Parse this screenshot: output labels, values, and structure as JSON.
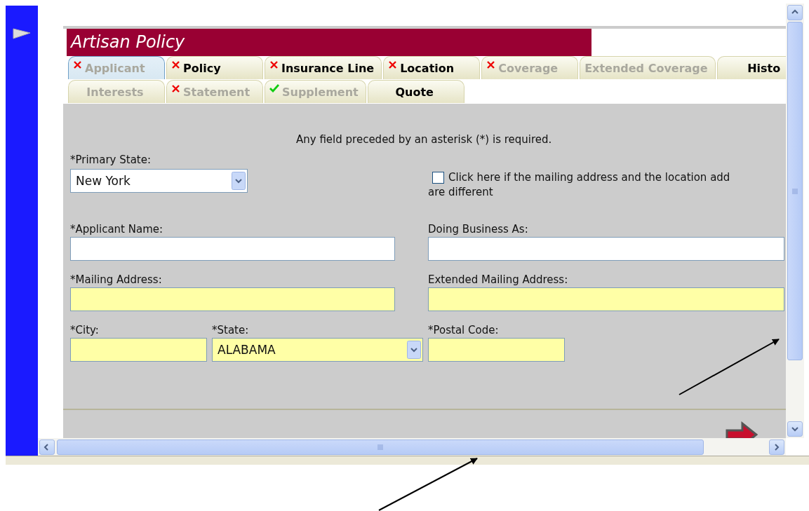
{
  "form_title": "Artisan Policy",
  "tab_rows": [
    {
      "tabs": [
        {
          "label": "Applicant",
          "kind": "error",
          "disabled": true,
          "selected": true
        },
        {
          "label": "Policy",
          "kind": "error",
          "disabled": false,
          "selected": false
        },
        {
          "label": "Insurance Line",
          "kind": "error",
          "disabled": false,
          "selected": false
        },
        {
          "label": "Location",
          "kind": "error",
          "disabled": false,
          "selected": false
        },
        {
          "label": "Coverage",
          "kind": "error",
          "disabled": true,
          "selected": false
        },
        {
          "label": "Extended Coverage",
          "kind": "plain",
          "disabled": true,
          "selected": false
        },
        {
          "label": "Histo",
          "kind": "plain",
          "disabled": false,
          "selected": false
        }
      ]
    },
    {
      "tabs": [
        {
          "label": "Interests",
          "kind": "plain",
          "disabled": true,
          "selected": false
        },
        {
          "label": "Statement",
          "kind": "error",
          "disabled": true,
          "selected": false
        },
        {
          "label": "Supplement",
          "kind": "complete",
          "disabled": true,
          "selected": false
        },
        {
          "label": "Quote",
          "kind": "plain",
          "disabled": false,
          "selected": false
        }
      ]
    }
  ],
  "notice": "Any field preceded by an asterisk (*) is required.",
  "primary_state": {
    "label": "*Primary State:",
    "value": "New York"
  },
  "mailing_checkbox": {
    "checked": false,
    "label_lines": [
      "Click here if the mailing address and the location add",
      "are different"
    ]
  },
  "fields": [
    {
      "label": "*Applicant Name:",
      "kind": "text",
      "highlighted": false
    },
    {
      "label": "Doing Business As:",
      "kind": "text",
      "highlighted": false
    },
    {
      "label": "*Mailing Address:",
      "kind": "text",
      "highlighted": true
    },
    {
      "label": "Extended Mailing Address:",
      "kind": "text",
      "highlighted": true
    },
    {
      "label": "*City:",
      "kind": "text",
      "highlighted": true
    },
    {
      "label": "*State:",
      "kind": "select",
      "value": "ALABAMA",
      "highlighted": true
    },
    {
      "label": "*Postal Code:",
      "kind": "text",
      "highlighted": true
    }
  ]
}
